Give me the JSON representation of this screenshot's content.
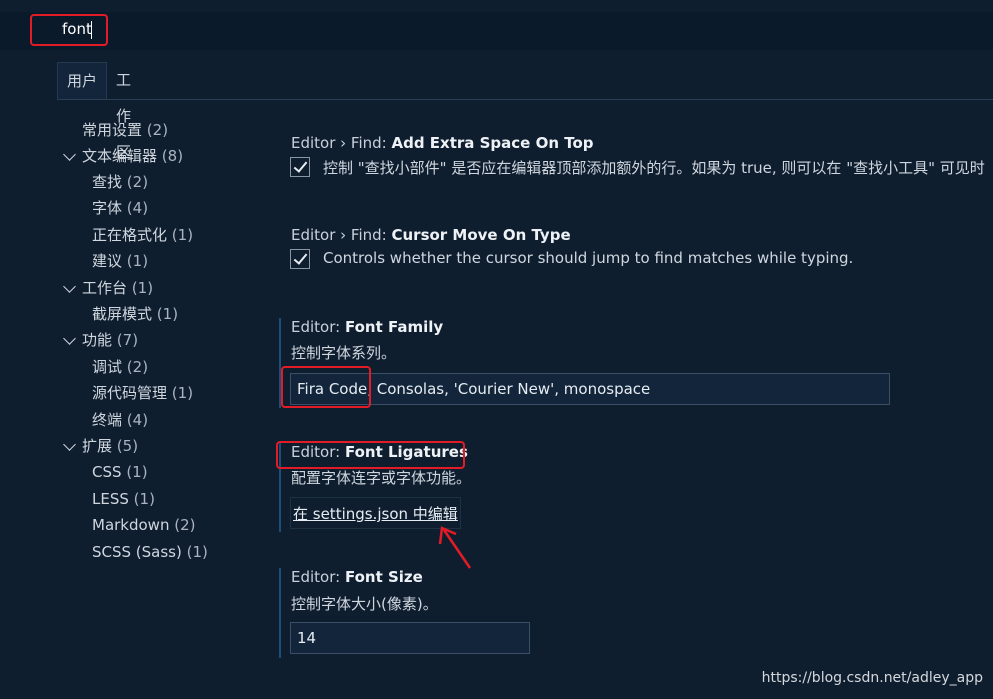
{
  "search": {
    "value": "font"
  },
  "tabs": [
    {
      "label": "用户",
      "active": true
    },
    {
      "label": "工作区",
      "active": false
    }
  ],
  "tree": {
    "items": [
      {
        "label": "常用设置",
        "count": "(2)",
        "expandable": false
      },
      {
        "label": "文本编辑器",
        "count": "(8)",
        "expandable": true
      },
      {
        "label": "查找",
        "count": "(2)",
        "expandable": false
      },
      {
        "label": "字体",
        "count": "(4)",
        "expandable": false
      },
      {
        "label": "正在格式化",
        "count": "(1)",
        "expandable": false
      },
      {
        "label": "建议",
        "count": "(1)",
        "expandable": false
      },
      {
        "label": "工作台",
        "count": "(1)",
        "expandable": true
      },
      {
        "label": "截屏模式",
        "count": "(1)",
        "expandable": false
      },
      {
        "label": "功能",
        "count": "(7)",
        "expandable": true
      },
      {
        "label": "调试",
        "count": "(2)",
        "expandable": false
      },
      {
        "label": "源代码管理",
        "count": "(1)",
        "expandable": false
      },
      {
        "label": "终端",
        "count": "(4)",
        "expandable": false
      },
      {
        "label": "扩展",
        "count": "(5)",
        "expandable": true
      },
      {
        "label": "CSS",
        "count": "(1)",
        "expandable": false
      },
      {
        "label": "LESS",
        "count": "(1)",
        "expandable": false
      },
      {
        "label": "Markdown",
        "count": "(2)",
        "expandable": false
      },
      {
        "label": "SCSS (Sass)",
        "count": "(1)",
        "expandable": false
      }
    ]
  },
  "settings": {
    "extra_space": {
      "prefix": "Editor › Find: ",
      "name": "Add Extra Space On Top",
      "description": "控制 \"查找小部件\" 是否应在编辑器顶部添加额外的行。如果为 true, 则可以在 \"查找小工具\" 可见时",
      "checked": true
    },
    "cursor_move": {
      "prefix": "Editor › Find: ",
      "name": "Cursor Move On Type",
      "description": "Controls whether the cursor should jump to find matches while typing.",
      "checked": true
    },
    "font_family": {
      "prefix": "Editor: ",
      "name": "Font Family",
      "description": "控制字体系列。",
      "value": "Fira Code, Consolas, 'Courier New', monospace"
    },
    "font_ligatures": {
      "prefix": "Editor: ",
      "name": "Font Ligatures",
      "description": "配置字体连字或字体功能。",
      "link": "在 settings.json 中编辑"
    },
    "font_size": {
      "prefix": "Editor: ",
      "name": "Font Size",
      "description": "控制字体大小(像素)。",
      "value": "14"
    }
  },
  "watermark": "https://blog.csdn.net/adley_app",
  "colors": {
    "background": "#0f1e2f",
    "highlight_box": "#e21c26",
    "setting_modified_bar": "#1f4d7a"
  }
}
